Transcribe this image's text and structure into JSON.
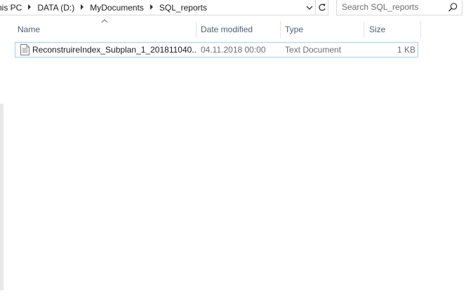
{
  "breadcrumb": {
    "items": [
      "his PC",
      "DATA (D:)",
      "MyDocuments",
      "SQL_reports"
    ]
  },
  "search": {
    "placeholder": "Search SQL_reports",
    "value": ""
  },
  "columns": {
    "name": "Name",
    "date_modified": "Date modified",
    "type": "Type",
    "size": "Size",
    "sort_column": "name"
  },
  "files": [
    {
      "name": "ReconstruireIndex_Subplan_1_201811040...",
      "date_modified": "04.11.2018 00:00",
      "type": "Text Document",
      "size": "1 KB",
      "icon": "text-document-icon"
    }
  ],
  "icons": {
    "breadcrumb_separator": "chevron-right-icon",
    "address_dropdown": "chevron-down-icon",
    "refresh": "refresh-icon",
    "search": "search-icon",
    "sort": "sort-ascending-icon"
  },
  "colors": {
    "header_text": "#4c607a",
    "row_border": "#99d1ff",
    "secondary_text": "#6d6d6d"
  }
}
